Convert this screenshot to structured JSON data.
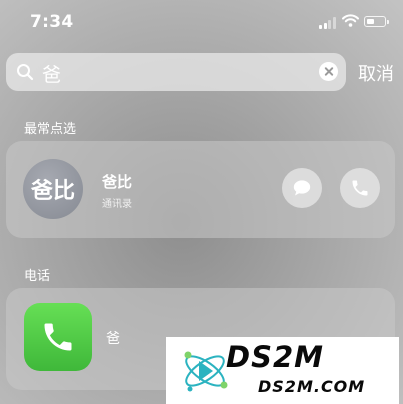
{
  "status_bar": {
    "time": "7:34"
  },
  "search": {
    "query": "爸",
    "cancel_label": "取消"
  },
  "top_hits": {
    "title": "最常点选",
    "contact": {
      "avatar_text": "爸比",
      "name": "爸比",
      "subtitle": "通讯录"
    }
  },
  "phone_section": {
    "title": "电话",
    "app": {
      "name": "爸"
    }
  },
  "watermark": {
    "title": "DS2M",
    "subtitle": "DS2M.COM"
  },
  "colors": {
    "phone_green": "#4cd049",
    "text": "#ffffff"
  }
}
